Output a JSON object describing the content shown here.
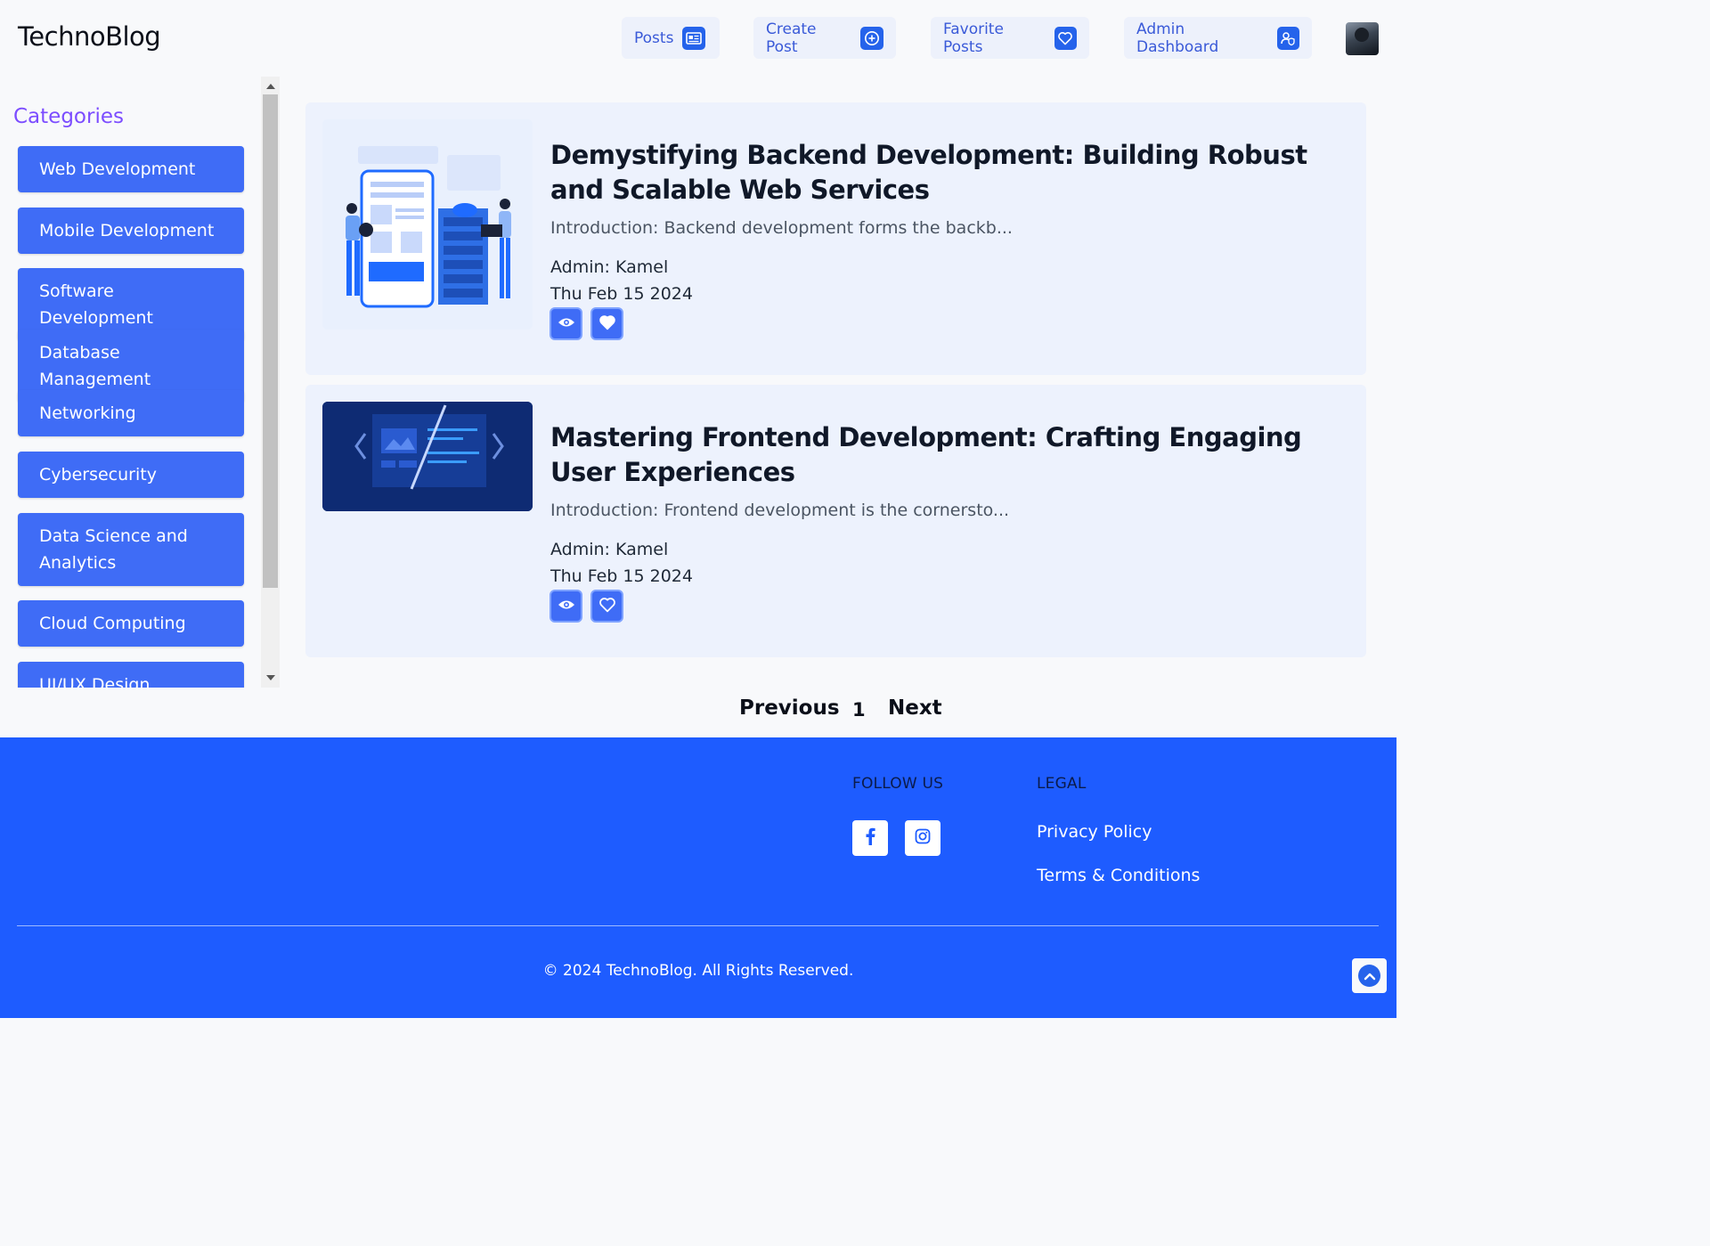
{
  "header": {
    "brand": "TechnoBlog",
    "nav": {
      "posts": {
        "label": "Posts",
        "icon": "newspaper-icon"
      },
      "create": {
        "label": "Create Post",
        "icon": "plus-circle-icon"
      },
      "favorites": {
        "label": "Favorite Posts",
        "icon": "heart-icon"
      },
      "admin": {
        "label": "Admin Dashboard",
        "icon": "user-shield-icon"
      }
    },
    "accent": "#2563eb"
  },
  "sidebar": {
    "title": "Categories",
    "items": [
      {
        "label": "Web Development"
      },
      {
        "label": "Mobile Development"
      },
      {
        "label": "Software Development"
      },
      {
        "label": "Database Management"
      },
      {
        "label": "Networking"
      },
      {
        "label": "Cybersecurity"
      },
      {
        "label": "Data Science and Analytics"
      },
      {
        "label": "Cloud Computing"
      },
      {
        "label": "UI/UX Design"
      }
    ]
  },
  "posts": [
    {
      "title": "Demystifying Backend Development: Building Robust and Scalable Web Services",
      "excerpt": "Introduction: Backend development forms the backb...",
      "author": "Admin: Kamel",
      "date": "Thu Feb 15 2024",
      "favorited": true
    },
    {
      "title": "Mastering Frontend Development: Crafting Engaging User Experiences",
      "excerpt": "Introduction: Frontend development is the cornersto...",
      "author": "Admin: Kamel",
      "date": "Thu Feb 15 2024",
      "favorited": false
    }
  ],
  "pagination": {
    "previous": "Previous",
    "current": "1",
    "next": "Next"
  },
  "footer": {
    "follow_heading": "FOLLOW US",
    "legal_heading": "LEGAL",
    "social": [
      "facebook-icon",
      "instagram-icon"
    ],
    "legal_links": [
      "Privacy Policy",
      "Terms & Conditions"
    ],
    "copyright": "© 2024 TechnoBlog. All Rights Reserved.",
    "background": "#1e5cff"
  }
}
